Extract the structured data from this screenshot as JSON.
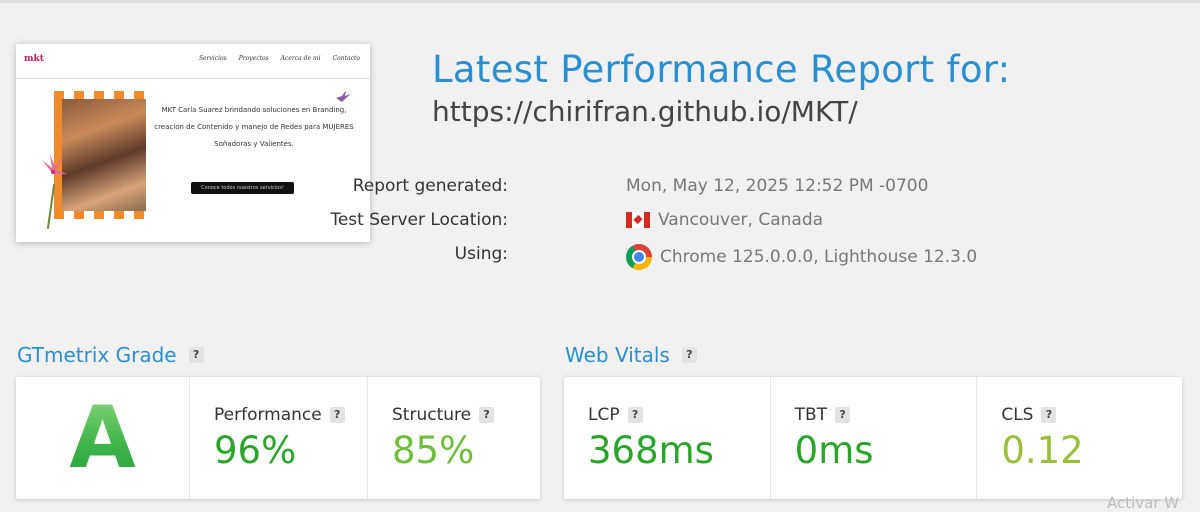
{
  "report": {
    "title": "Latest Performance Report for:",
    "url": "https://chirifran.github.io/MKT/"
  },
  "thumbnail": {
    "logo": "mkt",
    "nav": [
      "Servicios",
      "Proyectos",
      "Acerca de mi",
      "Contacto"
    ],
    "tagline": "MKT Carla Suarez brindando soluciones en Branding, creacion de Contenido y manejo de Redes para MUJERES Soñadoras y Valientes.",
    "cta": "Conoce todos nuestros servicios!"
  },
  "info": {
    "generated_label": "Report generated:",
    "generated_value": "Mon, May 12, 2025 12:52 PM -0700",
    "location_label": "Test Server Location:",
    "location_value": "Vancouver, Canada",
    "using_label": "Using:",
    "using_value": "Chrome 125.0.0.0, Lighthouse 12.3.0"
  },
  "icons": {
    "location_flag": "canada-flag-icon",
    "browser": "chrome-icon",
    "help": "question-icon"
  },
  "gtmetrix": {
    "title": "GTmetrix Grade",
    "help": "?",
    "grade": "A",
    "performance_label": "Performance",
    "performance_value": "96%",
    "structure_label": "Structure",
    "structure_value": "85%"
  },
  "web_vitals": {
    "title": "Web Vitals",
    "help": "?",
    "lcp_label": "LCP",
    "lcp_value": "368ms",
    "tbt_label": "TBT",
    "tbt_value": "0ms",
    "cls_label": "CLS",
    "cls_value": "0.12"
  },
  "colors": {
    "accent": "#2a8fd0",
    "good_green": "#2aa52a",
    "ok_green": "#6fbf3a",
    "lime": "#9abf3a"
  },
  "watermark": "Activar W"
}
